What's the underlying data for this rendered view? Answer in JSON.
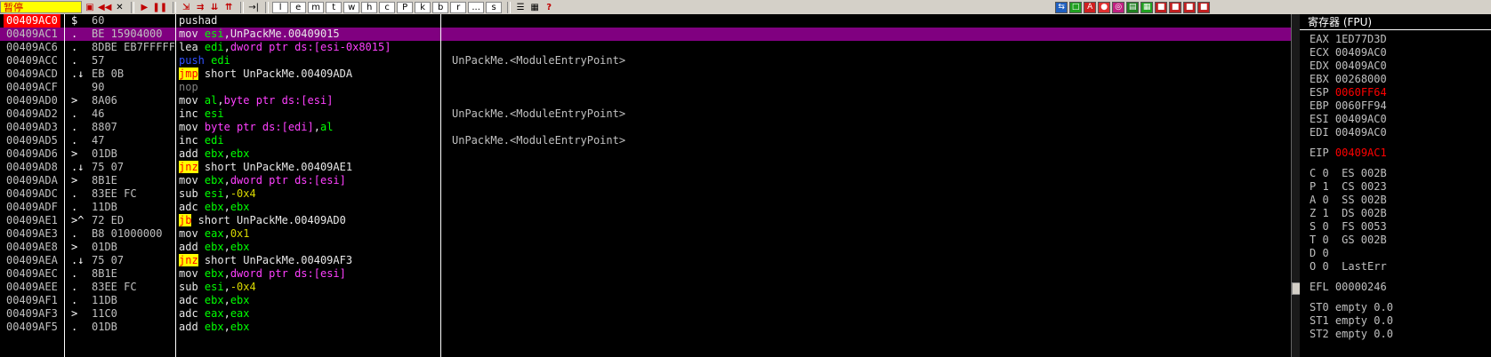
{
  "toolbar": {
    "status": "暂停",
    "letters": [
      "l",
      "e",
      "m",
      "t",
      "w",
      "h",
      "c",
      "P",
      "k",
      "b",
      "r",
      "...",
      "s"
    ]
  },
  "rows": [
    {
      "addr": "00409AC0",
      "mark": "$",
      "hex": "60",
      "dis": [
        [
          "m",
          "pushad"
        ]
      ],
      "comment": ""
    },
    {
      "addr": "00409AC1",
      "mark": ".",
      "hex": "BE 15904000",
      "dis": [
        [
          "m",
          "mov "
        ],
        [
          "r",
          "esi"
        ],
        [
          "m",
          ",UnPackMe.00409015"
        ]
      ],
      "comment": ""
    },
    {
      "addr": "00409AC6",
      "mark": ".",
      "hex": "8DBE EB7FFFFF",
      "dis": [
        [
          "m",
          "lea "
        ],
        [
          "r",
          "edi"
        ],
        [
          "m",
          ","
        ],
        [
          "k",
          "dword ptr ds:[esi-0x8015]"
        ]
      ],
      "comment": ""
    },
    {
      "addr": "00409ACC",
      "mark": ".",
      "hex": "57",
      "dis": [
        [
          "p",
          "push "
        ],
        [
          "r",
          "edi"
        ]
      ],
      "comment": "UnPackMe.<ModuleEntryPoint>"
    },
    {
      "addr": "00409ACD",
      "mark": ".↓",
      "hex": "EB 0B",
      "dis": [
        [
          "j",
          "jmp"
        ],
        [
          "m",
          " short UnPackMe.00409ADA"
        ]
      ],
      "comment": ""
    },
    {
      "addr": "00409ACF",
      "mark": "",
      "hex": "90",
      "dis": [
        [
          "g",
          "nop"
        ]
      ],
      "comment": ""
    },
    {
      "addr": "00409AD0",
      "mark": ">",
      "hex": "8A06",
      "dis": [
        [
          "m",
          "mov "
        ],
        [
          "r",
          "al"
        ],
        [
          "m",
          ","
        ],
        [
          "k",
          "byte ptr ds:[esi]"
        ]
      ],
      "comment": ""
    },
    {
      "addr": "00409AD2",
      "mark": ".",
      "hex": "46",
      "dis": [
        [
          "m",
          "inc "
        ],
        [
          "r",
          "esi"
        ]
      ],
      "comment": "UnPackMe.<ModuleEntryPoint>"
    },
    {
      "addr": "00409AD3",
      "mark": ".",
      "hex": "8807",
      "dis": [
        [
          "m",
          "mov "
        ],
        [
          "k",
          "byte ptr ds:[edi]"
        ],
        [
          "m",
          ","
        ],
        [
          "r",
          "al"
        ]
      ],
      "comment": ""
    },
    {
      "addr": "00409AD5",
      "mark": ".",
      "hex": "47",
      "dis": [
        [
          "m",
          "inc "
        ],
        [
          "r",
          "edi"
        ]
      ],
      "comment": "UnPackMe.<ModuleEntryPoint>"
    },
    {
      "addr": "00409AD6",
      "mark": ">",
      "hex": "01DB",
      "dis": [
        [
          "m",
          "add "
        ],
        [
          "r",
          "ebx"
        ],
        [
          "m",
          ","
        ],
        [
          "r",
          "ebx"
        ]
      ],
      "comment": ""
    },
    {
      "addr": "00409AD8",
      "mark": ".↓",
      "hex": "75 07",
      "dis": [
        [
          "j",
          "jnz"
        ],
        [
          "m",
          " short UnPackMe.00409AE1"
        ]
      ],
      "comment": ""
    },
    {
      "addr": "00409ADA",
      "mark": ">",
      "hex": "8B1E",
      "dis": [
        [
          "m",
          "mov "
        ],
        [
          "r",
          "ebx"
        ],
        [
          "m",
          ","
        ],
        [
          "k",
          "dword ptr ds:[esi]"
        ]
      ],
      "comment": ""
    },
    {
      "addr": "00409ADC",
      "mark": ".",
      "hex": "83EE FC",
      "dis": [
        [
          "m",
          "sub "
        ],
        [
          "r",
          "esi"
        ],
        [
          "m",
          ","
        ],
        [
          "i",
          "-0x4"
        ]
      ],
      "comment": ""
    },
    {
      "addr": "00409ADF",
      "mark": ".",
      "hex": "11DB",
      "dis": [
        [
          "m",
          "adc "
        ],
        [
          "r",
          "ebx"
        ],
        [
          "m",
          ","
        ],
        [
          "r",
          "ebx"
        ]
      ],
      "comment": ""
    },
    {
      "addr": "00409AE1",
      "mark": ">^",
      "hex": "72 ED",
      "dis": [
        [
          "j",
          "jb"
        ],
        [
          "m",
          " short UnPackMe.00409AD0"
        ]
      ],
      "comment": ""
    },
    {
      "addr": "00409AE3",
      "mark": ".",
      "hex": "B8 01000000",
      "dis": [
        [
          "m",
          "mov "
        ],
        [
          "r",
          "eax"
        ],
        [
          "m",
          ","
        ],
        [
          "i",
          "0x1"
        ]
      ],
      "comment": ""
    },
    {
      "addr": "00409AE8",
      "mark": ">",
      "hex": "01DB",
      "dis": [
        [
          "m",
          "add "
        ],
        [
          "r",
          "ebx"
        ],
        [
          "m",
          ","
        ],
        [
          "r",
          "ebx"
        ]
      ],
      "comment": ""
    },
    {
      "addr": "00409AEA",
      "mark": ".↓",
      "hex": "75 07",
      "dis": [
        [
          "j",
          "jnz"
        ],
        [
          "m",
          " short UnPackMe.00409AF3"
        ]
      ],
      "comment": ""
    },
    {
      "addr": "00409AEC",
      "mark": ".",
      "hex": "8B1E",
      "dis": [
        [
          "m",
          "mov "
        ],
        [
          "r",
          "ebx"
        ],
        [
          "m",
          ","
        ],
        [
          "k",
          "dword ptr ds:[esi]"
        ]
      ],
      "comment": ""
    },
    {
      "addr": "00409AEE",
      "mark": ".",
      "hex": "83EE FC",
      "dis": [
        [
          "m",
          "sub "
        ],
        [
          "r",
          "esi"
        ],
        [
          "m",
          ","
        ],
        [
          "i",
          "-0x4"
        ]
      ],
      "comment": ""
    },
    {
      "addr": "00409AF1",
      "mark": ".",
      "hex": "11DB",
      "dis": [
        [
          "m",
          "adc "
        ],
        [
          "r",
          "ebx"
        ],
        [
          "m",
          ","
        ],
        [
          "r",
          "ebx"
        ]
      ],
      "comment": ""
    },
    {
      "addr": "00409AF3",
      "mark": ">",
      "hex": "11C0",
      "dis": [
        [
          "m",
          "adc "
        ],
        [
          "r",
          "eax"
        ],
        [
          "m",
          ","
        ],
        [
          "r",
          "eax"
        ]
      ],
      "comment": ""
    },
    {
      "addr": "00409AF5",
      "mark": ".",
      "hex": "01DB",
      "dis": [
        [
          "m",
          "add "
        ],
        [
          "r",
          "ebx"
        ],
        [
          "m",
          ","
        ],
        [
          "r",
          "ebx"
        ]
      ],
      "comment": ""
    }
  ],
  "current_row": 0,
  "selected_row": 1,
  "registers": {
    "title": "寄存器 (FPU)",
    "gp": [
      {
        "name": "EAX",
        "value": "1ED77D3D",
        "changed": false
      },
      {
        "name": "ECX",
        "value": "00409AC0",
        "changed": false
      },
      {
        "name": "EDX",
        "value": "00409AC0",
        "changed": false
      },
      {
        "name": "EBX",
        "value": "00268000",
        "changed": false
      },
      {
        "name": "ESP",
        "value": "0060FF64",
        "changed": true
      },
      {
        "name": "EBP",
        "value": "0060FF94",
        "changed": false
      },
      {
        "name": "ESI",
        "value": "00409AC0",
        "changed": false
      },
      {
        "name": "EDI",
        "value": "00409AC0",
        "changed": false
      }
    ],
    "eip": {
      "name": "EIP",
      "value": "00409AC1",
      "changed": true
    },
    "flags": [
      "C 0  ES 002B",
      "P 1  CS 0023",
      "A 0  SS 002B",
      "Z 1  DS 002B",
      "S 0  FS 0053",
      "T 0  GS 002B",
      "D 0",
      "O 0  LastErr"
    ],
    "efl": {
      "name": "EFL",
      "value": "00000246"
    },
    "fpu": [
      "ST0 empty 0.0",
      "ST1 empty 0.0",
      "ST2 empty 0.0"
    ]
  },
  "colors": {
    "selection": "#800080",
    "current_addr": "#ff0000",
    "jump_highlight": "#ffff00",
    "register": "#00ff00",
    "memory": "#ff40ff"
  }
}
